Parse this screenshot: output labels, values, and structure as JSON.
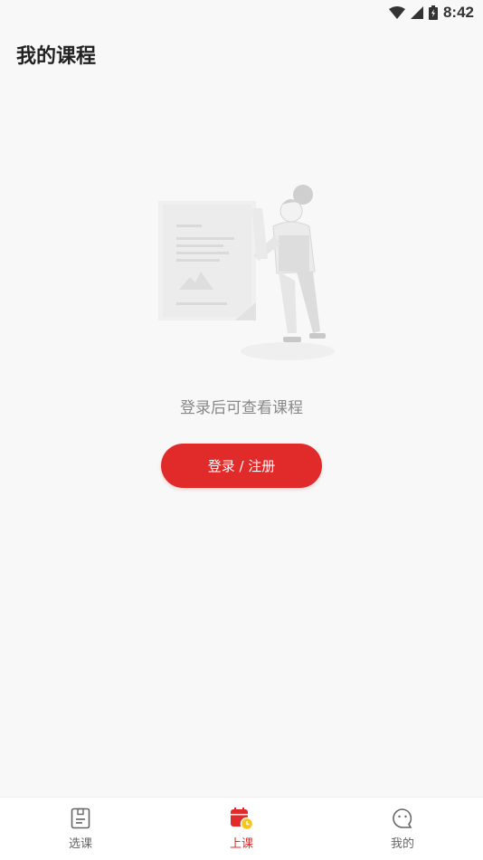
{
  "status_bar": {
    "time": "8:42",
    "icons": [
      "wifi-icon",
      "signal-icon",
      "battery-icon"
    ]
  },
  "header": {
    "title": "我的课程"
  },
  "empty_state": {
    "illustration": "person-with-document-illustration",
    "message": "登录后可查看课程"
  },
  "login_button": {
    "label": "登录 / 注册"
  },
  "bottom_nav": {
    "items": [
      {
        "label": "选课",
        "icon": "document-icon",
        "active": false
      },
      {
        "label": "上课",
        "icon": "calendar-clock-icon",
        "active": true
      },
      {
        "label": "我的",
        "icon": "chat-face-icon",
        "active": false
      }
    ]
  },
  "colors": {
    "accent": "#e12a2a",
    "background": "#f8f8f8",
    "inactive_nav": "#666666"
  }
}
